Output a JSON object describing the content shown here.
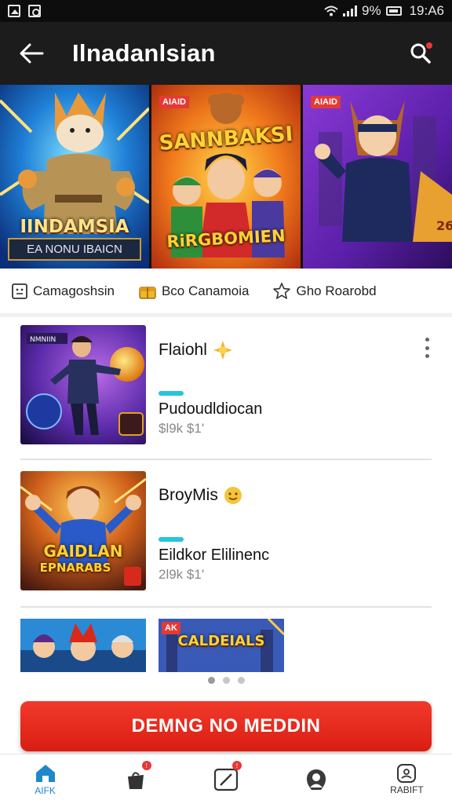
{
  "status_bar": {
    "battery": "9%",
    "time": "19:A6"
  },
  "app_bar": {
    "title": "Ilnadanlsian"
  },
  "banners": [
    {
      "title": "IINDAMSIA",
      "subtitle": "EA NONU IBAICN"
    },
    {
      "tag": "AIAID",
      "title": "SANNBAKSI",
      "subtitle": "RiRGBOMIEN"
    },
    {
      "tag": "AIAID"
    }
  ],
  "categories": [
    {
      "label": "Camagoshsin",
      "icon": "grid-icon"
    },
    {
      "label": "Bco Canamoia",
      "icon": "gift-icon"
    },
    {
      "label": "Gho Roarobd",
      "icon": "star-icon"
    }
  ],
  "list": [
    {
      "title": "Flaiohl",
      "subtitle": "Pudoudldiocan",
      "meta": "$l9k $1'"
    },
    {
      "title": "BroyMis",
      "subtitle": "Eildkor Elilinenc",
      "meta": "2l9k $1'",
      "thumb_title": "GAIDLAN",
      "thumb_sub": "EPNARABS"
    }
  ],
  "mini": [
    {},
    {
      "title": "CALDEIALS",
      "tag": "AK"
    }
  ],
  "cta": {
    "label": "DEMNG NO MEDDIN"
  },
  "bottom_nav": [
    {
      "label": "AIFK",
      "icon": "home-icon",
      "active": true
    },
    {
      "label": "",
      "icon": "bag-icon",
      "badge": "!"
    },
    {
      "label": "",
      "icon": "edit-icon",
      "badge": "!"
    },
    {
      "label": "",
      "icon": "profile-icon"
    },
    {
      "label": "RABIFT",
      "icon": "account-icon"
    }
  ],
  "colors": {
    "accent": "#e53935",
    "appbar": "#1c1c1c",
    "cyan": "#26c6da"
  }
}
